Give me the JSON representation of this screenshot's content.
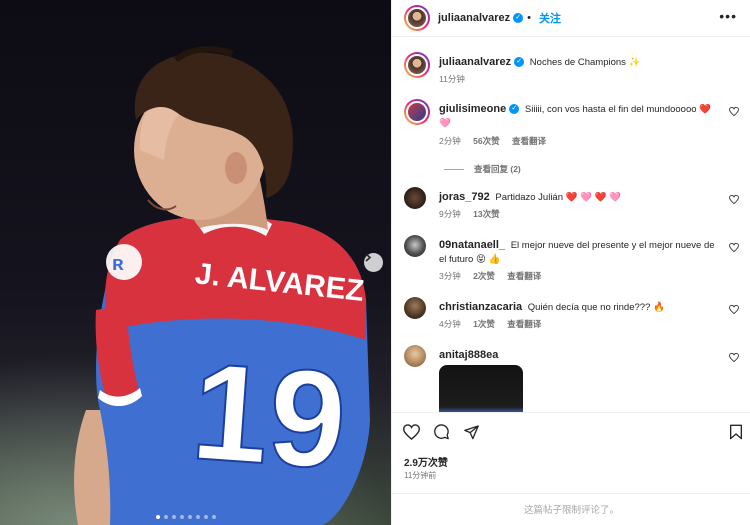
{
  "post": {
    "username": "juliaanalvarez",
    "follow_label": "关注",
    "dot": "•",
    "more_label": "•••",
    "caption": "Noches de Champions ✨",
    "caption_time": "11分钟",
    "likes": "2.9万次赞",
    "posted_time": "11分钟前",
    "comments_restricted": "这篇帖子限制评论了。"
  },
  "photo": {
    "jersey_name": "J. ALVAREZ",
    "jersey_number": "19",
    "sponsor": "Riyadh Air",
    "carousel_count": 8,
    "carousel_active": 0
  },
  "comments": [
    {
      "username": "giulisimeone",
      "verified": true,
      "text_line1": "Siiiii, con vos hasta el fin del mundooooo ❤️",
      "text_line2": "🩷",
      "time": "2分钟",
      "likes": "56次赞",
      "translate": "查看翻译",
      "replies": "查看回复 (2)"
    },
    {
      "username": "joras_792",
      "text": "Partidazo Julián ❤️ 🩷 ❤️ 🩷",
      "time": "9分钟",
      "likes": "13次赞"
    },
    {
      "username": "09natanaell_",
      "text_line1": "El mejor nueve del presente y el mejor nueve de",
      "text_line2": "el futuro 😝 👍",
      "time": "3分钟",
      "likes": "2次赞",
      "translate": "查看翻译"
    },
    {
      "username": "christianzacaria",
      "text": "Quién decía que no rinde??? 🔥",
      "time": "4分钟",
      "likes": "1次赞",
      "translate": "查看翻译"
    },
    {
      "username": "anitaj888ea"
    }
  ],
  "colors": {
    "accent": "#0095f6",
    "text": "#262626",
    "muted": "#737373",
    "jersey_red": "#d9323f",
    "jersey_blue": "#3f6fd0"
  }
}
